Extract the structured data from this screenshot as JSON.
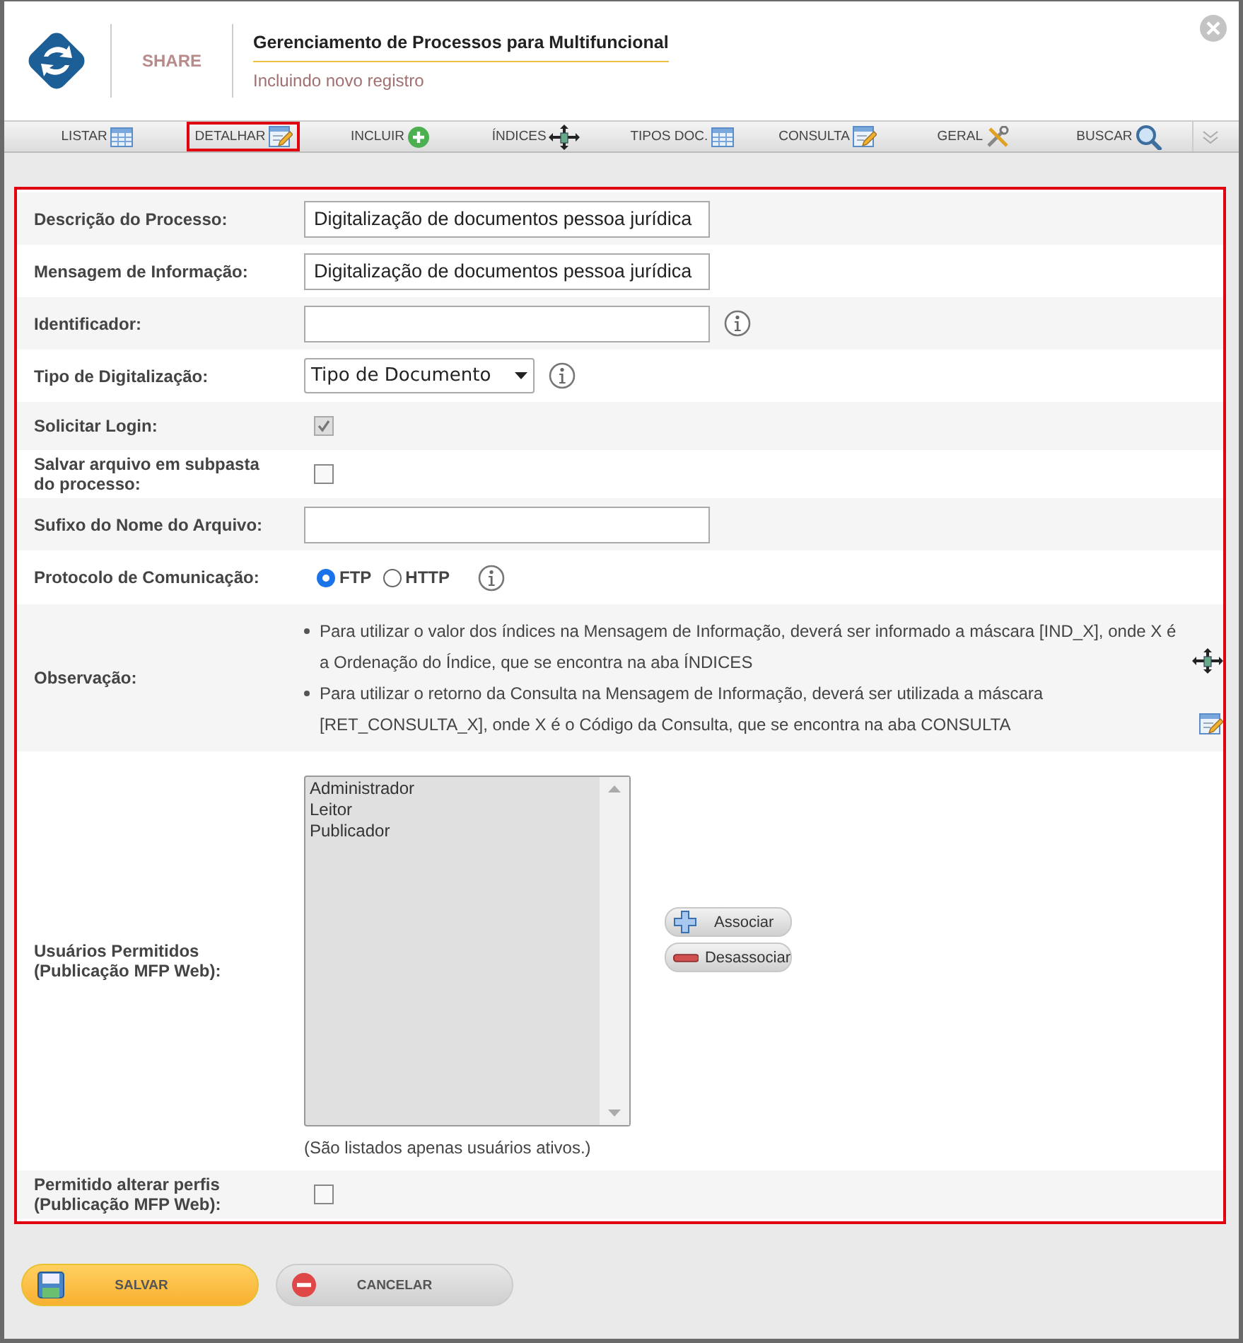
{
  "header": {
    "brand": "SHARE",
    "title": "Gerenciamento de Processos para Multifuncional",
    "subtitle": "Incluindo novo registro"
  },
  "toolbar": [
    {
      "label": "LISTAR",
      "selected": false
    },
    {
      "label": "DETALHAR",
      "selected": true
    },
    {
      "label": "INCLUIR",
      "selected": false
    },
    {
      "label": "ÍNDICES",
      "selected": false
    },
    {
      "label": "TIPOS DOC.",
      "selected": false
    },
    {
      "label": "CONSULTA",
      "selected": false
    },
    {
      "label": "GERAL",
      "selected": false
    },
    {
      "label": "BUSCAR",
      "selected": false
    }
  ],
  "form": [
    {
      "kind": "text",
      "label": "Descrição do Processo:",
      "value": "Digitalização de documentos pessoa jurídica",
      "info": false
    },
    {
      "kind": "text",
      "label": "Mensagem de Informação:",
      "value": "Digitalização de documentos pessoa jurídica",
      "info": false
    },
    {
      "kind": "text",
      "label": "Identificador:",
      "info": true
    },
    {
      "kind": "select",
      "label": "Tipo de Digitalização:",
      "value": "Tipo de Documento",
      "info": true
    },
    {
      "kind": "checkbox",
      "label": "Solicitar Login:",
      "checked": true,
      "disabled": true
    },
    {
      "kind": "checkbox",
      "label": "Salvar arquivo em subpasta do processo:",
      "checked": false,
      "disabled": false
    },
    {
      "kind": "text",
      "label": "Sufixo do Nome do Arquivo:",
      "info": false
    },
    {
      "kind": "radio",
      "label": "Protocolo de Comunicação:",
      "options": [
        {
          "label": "FTP",
          "selected": true
        },
        {
          "label": "HTTP",
          "selected": false
        }
      ],
      "info": true
    },
    {
      "kind": "notes",
      "label": "Observação:",
      "notes": [
        "Para utilizar o valor dos índices na Mensagem de Informação, deverá ser informado a máscara [IND_X], onde X é a Ordenação do Índice, que se encontra na aba ÍNDICES",
        "Para utilizar o retorno da Consulta na Mensagem de Informação, deverá ser utilizada a máscara [RET_CONSULTA_X], onde X é o Código da Consulta, que se encontra na aba CONSULTA"
      ]
    },
    {
      "kind": "listbox",
      "label": "Usuários Permitidos (Publicação MFP Web):",
      "items": [
        "Administrador",
        "Leitor",
        "Publicador"
      ],
      "hint": "(São listados apenas usuários ativos.)",
      "buttons": [
        "Associar",
        "Desassociar"
      ]
    },
    {
      "kind": "checkbox",
      "label": "Permitido alterar perfis (Publicação MFP Web):",
      "checked": false,
      "disabled": false
    }
  ],
  "footer": {
    "save": "SALVAR",
    "cancel": "CANCELAR"
  }
}
